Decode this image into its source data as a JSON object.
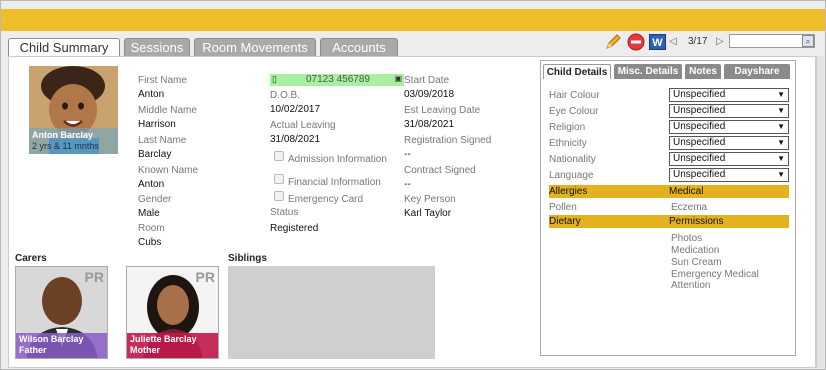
{
  "tabs": [
    {
      "label": "Child Summary",
      "active": true
    },
    {
      "label": "Sessions"
    },
    {
      "label": "Room Movements"
    },
    {
      "label": "Accounts"
    }
  ],
  "toolbar": {
    "record_position": "3/17",
    "search_value": "",
    "doc_label": "W"
  },
  "child": {
    "photo_name": "Anton Barclay",
    "photo_age": "2 yrs & 11 mnths",
    "first_name_label": "First Name",
    "first_name": "Anton",
    "middle_name_label": "Middle Name",
    "middle_name": "Harrison",
    "last_name_label": "Last Name",
    "last_name": "Barclay",
    "known_name_label": "Known Name",
    "known_name": "Anton",
    "gender_label": "Gender",
    "gender": "Male",
    "room_label": "Room",
    "room": "Cubs",
    "phone": "07123 456789",
    "dob_label": "D.O.B.",
    "dob": "10/02/2017",
    "actual_leaving_label": "Actual Leaving",
    "actual_leaving": "31/08/2021",
    "admission_label": "Admission Information",
    "financial_label": "Financial Information",
    "emergency_label": "Emergency Card",
    "status_label": "Status",
    "status": "Registered",
    "start_date_label": "Start Date",
    "start_date": "03/09/2018",
    "est_leaving_label": "Est Leaving Date",
    "est_leaving": "31/08/2021",
    "registration_label": "Registration Signed",
    "registration": "--",
    "contract_label": "Contract Signed",
    "contract": "--",
    "key_person_label": "Key Person",
    "key_person": "Karl Taylor"
  },
  "carers": {
    "heading": "Carers",
    "items": [
      {
        "name": "Wilson Barclay",
        "relation": "Father",
        "badge": "PR"
      },
      {
        "name": "Juliette Barclay",
        "relation": "Mother",
        "badge": "PR"
      }
    ]
  },
  "siblings": {
    "heading": "Siblings"
  },
  "details": {
    "tabs": [
      "Child Details",
      "Misc. Details",
      "Notes",
      "Dayshare"
    ],
    "fields": [
      {
        "label": "Hair Colour",
        "value": "Unspecified"
      },
      {
        "label": "Eye Colour",
        "value": "Unspecified"
      },
      {
        "label": "Religion",
        "value": "Unspecified"
      },
      {
        "label": "Ethnicity",
        "value": "Unspecified"
      },
      {
        "label": "Nationality",
        "value": "Unspecified"
      },
      {
        "label": "Language",
        "value": "Unspecified"
      }
    ],
    "allergies_label": "Allergies",
    "medical_label": "Medical",
    "allergy_item": "Pollen",
    "medical_item": "Eczema",
    "dietary_label": "Dietary",
    "permissions_label": "Permissions",
    "permissions": [
      "Photos",
      "Medication",
      "Sun Cream",
      "Emergency Medical Attention"
    ]
  },
  "colors": {
    "accent": "#eebf2b",
    "band": "#e3b21e",
    "phone_bg": "#a6f0a0",
    "father_caption": "#8a5ec8",
    "mother_caption": "#c0184a"
  }
}
